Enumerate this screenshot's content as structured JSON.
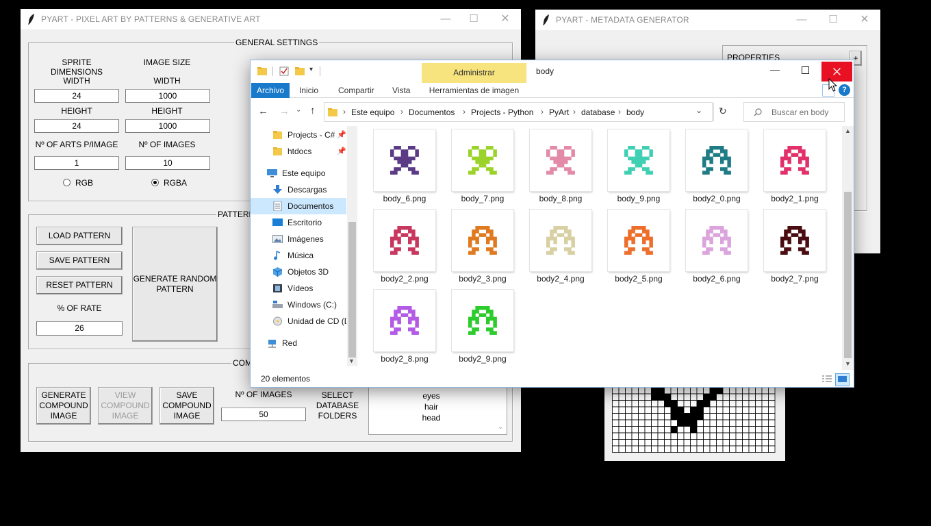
{
  "main_window": {
    "title": "PYART - PIXEL ART BY PATTERNS & GENERATIVE ART",
    "general_settings": {
      "title": "GENERAL SETTINGS",
      "sprite_dimensions": "SPRITE DIMENSIONS",
      "image_size": "IMAGE SIZE",
      "width_label": "WIDTH",
      "height_label": "HEIGHT",
      "sprite_width": "24",
      "sprite_height": "24",
      "image_width": "1000",
      "image_height": "1000",
      "arts_per_image_label": "Nº OF ARTS P/IMAGE",
      "arts_per_image": "1",
      "num_images_label": "Nº OF IMAGES",
      "num_images": "10",
      "rgb_label": "RGB",
      "rgba_label": "RGBA",
      "selected_mode": "RGBA"
    },
    "pattern": {
      "title": "PATTERN",
      "load": "LOAD PATTERN",
      "save": "SAVE PATTERN",
      "reset": "RESET PATTERN",
      "rate_label": "% OF RATE",
      "rate": "26",
      "generate_random_line1": "GENERATE RANDOM",
      "generate_random_line2": "PATTERN"
    },
    "compound": {
      "title": "COM",
      "generate": [
        "GENERATE",
        "COMPOUND",
        "IMAGE"
      ],
      "view": [
        "VIEW",
        "COMPOUND",
        "IMAGE"
      ],
      "save": [
        "SAVE",
        "COMPOUND",
        "IMAGE"
      ],
      "num_images_label": "Nº OF IMAGES",
      "num_images": "50",
      "select_folders": [
        "SELECT",
        "DATABASE",
        "FOLDERS"
      ],
      "folders": [
        "eyes",
        "hair",
        "head"
      ]
    }
  },
  "metadata_window": {
    "title": "PYART - METADATA GENERATOR",
    "properties_label": "PROPERTIES",
    "add_label": "+"
  },
  "explorer": {
    "title": "body",
    "manage_tab": "Administrar",
    "image_tools_tab": "Herramientas de imagen",
    "tabs": [
      "Archivo",
      "Inicio",
      "Compartir",
      "Vista"
    ],
    "breadcrumb": [
      "Este equipo",
      "Documentos",
      "Projects - Python",
      "PyArt",
      "database",
      "body"
    ],
    "search_placeholder": "Buscar en body",
    "nav_items": [
      {
        "label": "Projects - C#",
        "icon": "folder-icon",
        "pinned": true
      },
      {
        "label": "htdocs",
        "icon": "folder-icon",
        "pinned": true
      },
      {
        "label": "Este equipo",
        "icon": "computer-icon"
      },
      {
        "label": "Descargas",
        "icon": "downloads-icon"
      },
      {
        "label": "Documentos",
        "icon": "documents-icon",
        "selected": true
      },
      {
        "label": "Escritorio",
        "icon": "desktop-icon"
      },
      {
        "label": "Imágenes",
        "icon": "pictures-icon"
      },
      {
        "label": "Música",
        "icon": "music-icon"
      },
      {
        "label": "Objetos 3D",
        "icon": "objects-3d-icon"
      },
      {
        "label": "Vídeos",
        "icon": "videos-icon"
      },
      {
        "label": "Windows (C:)",
        "icon": "drive-icon"
      },
      {
        "label": "Unidad de CD (D",
        "icon": "cd-drive-icon"
      },
      {
        "label": "Red",
        "icon": "network-icon"
      }
    ],
    "files": [
      {
        "name": "body_6.png",
        "color": "#5b3a86",
        "shape": "goblet"
      },
      {
        "name": "body_7.png",
        "color": "#9bd32b",
        "shape": "goblet"
      },
      {
        "name": "body_8.png",
        "color": "#e28aa8",
        "shape": "goblet"
      },
      {
        "name": "body_9.png",
        "color": "#3fd0b4",
        "shape": "goblet"
      },
      {
        "name": "body2_0.png",
        "color": "#1f7c86",
        "shape": "penguin"
      },
      {
        "name": "body2_1.png",
        "color": "#e2306a",
        "shape": "penguin"
      },
      {
        "name": "body2_2.png",
        "color": "#c8375e",
        "shape": "penguin"
      },
      {
        "name": "body2_3.png",
        "color": "#e07a20",
        "shape": "penguin"
      },
      {
        "name": "body2_4.png",
        "color": "#d8cfa3",
        "shape": "penguin"
      },
      {
        "name": "body2_5.png",
        "color": "#ee6e2c",
        "shape": "penguin"
      },
      {
        "name": "body2_6.png",
        "color": "#dca4dc",
        "shape": "penguin"
      },
      {
        "name": "body2_7.png",
        "color": "#4a0d12",
        "shape": "penguin"
      },
      {
        "name": "body2_8.png",
        "color": "#b45ae6",
        "shape": "penguin"
      },
      {
        "name": "body2_9.png",
        "color": "#2ccc2c",
        "shape": "penguin"
      }
    ],
    "item_count": "20 elementos"
  },
  "colors": {
    "close_red": "#e81123",
    "file_tab_blue": "#1979ca",
    "manage_yellow": "#f8e47e",
    "nav_selected": "#cce8ff"
  }
}
